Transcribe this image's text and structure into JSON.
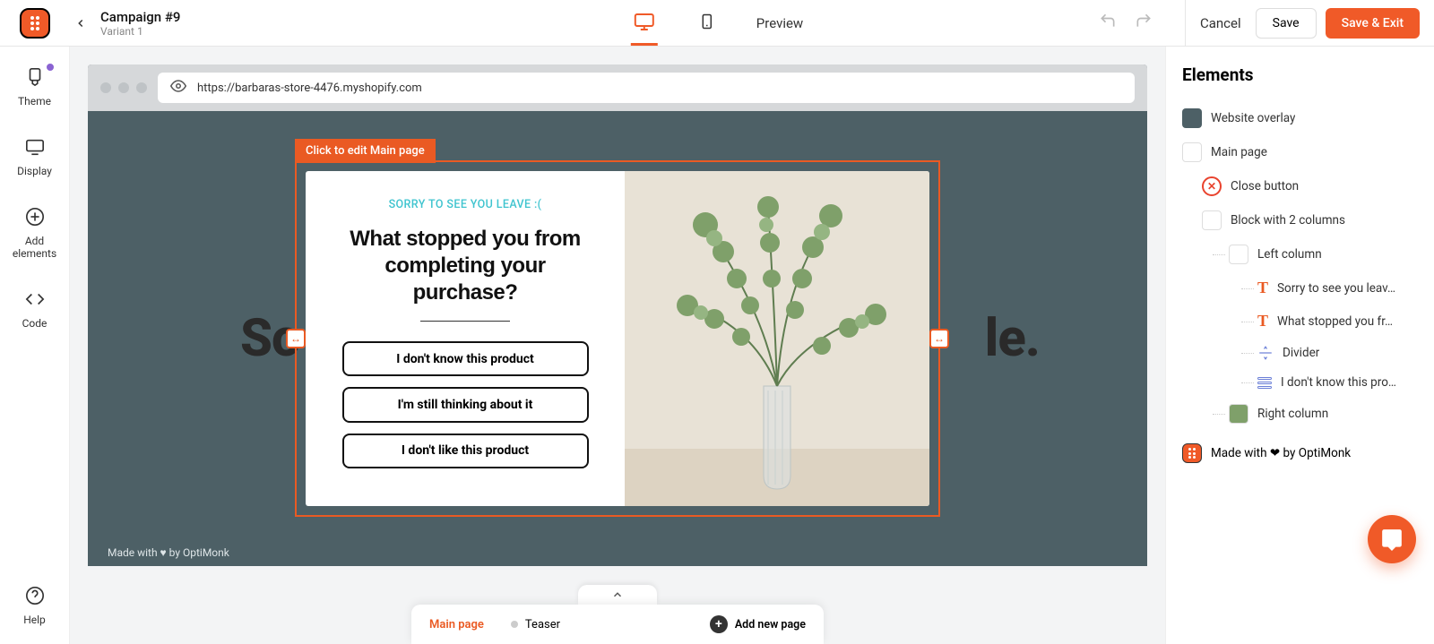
{
  "header": {
    "title": "Campaign #9",
    "subtitle": "Variant 1",
    "preview": "Preview",
    "cancel": "Cancel",
    "save": "Save",
    "save_exit": "Save & Exit"
  },
  "rail": {
    "theme": "Theme",
    "display": "Display",
    "add": "Add elements",
    "code": "Code",
    "help": "Help"
  },
  "canvas": {
    "url": "https://barbaras-store-4476.myshopify.com",
    "edit_tag": "Click to edit Main page",
    "background_heading_left": "So",
    "background_heading_right": "le.",
    "made_with": "Made with ♥ by OptiMonk"
  },
  "popup": {
    "eyebrow": "SORRY TO SEE YOU LEAVE :(",
    "headline": "What stopped you from completing your purchase?",
    "options": [
      "I don't know this product",
      "I'm still thinking about it",
      "I don't like this product"
    ]
  },
  "pages": {
    "expand_icon": "chevron-up",
    "main": "Main page",
    "teaser": "Teaser",
    "add": "Add new page"
  },
  "panel": {
    "title": "Elements",
    "tree": {
      "overlay": "Website overlay",
      "main": "Main page",
      "close": "Close button",
      "block": "Block with 2 columns",
      "left": "Left column",
      "t1": "Sorry to see you leav…",
      "t2": "What stopped you fr…",
      "divider": "Divider",
      "survey": "I don't know this pro…",
      "right": "Right column"
    },
    "brand": "Made with ❤ by OptiMonk"
  }
}
